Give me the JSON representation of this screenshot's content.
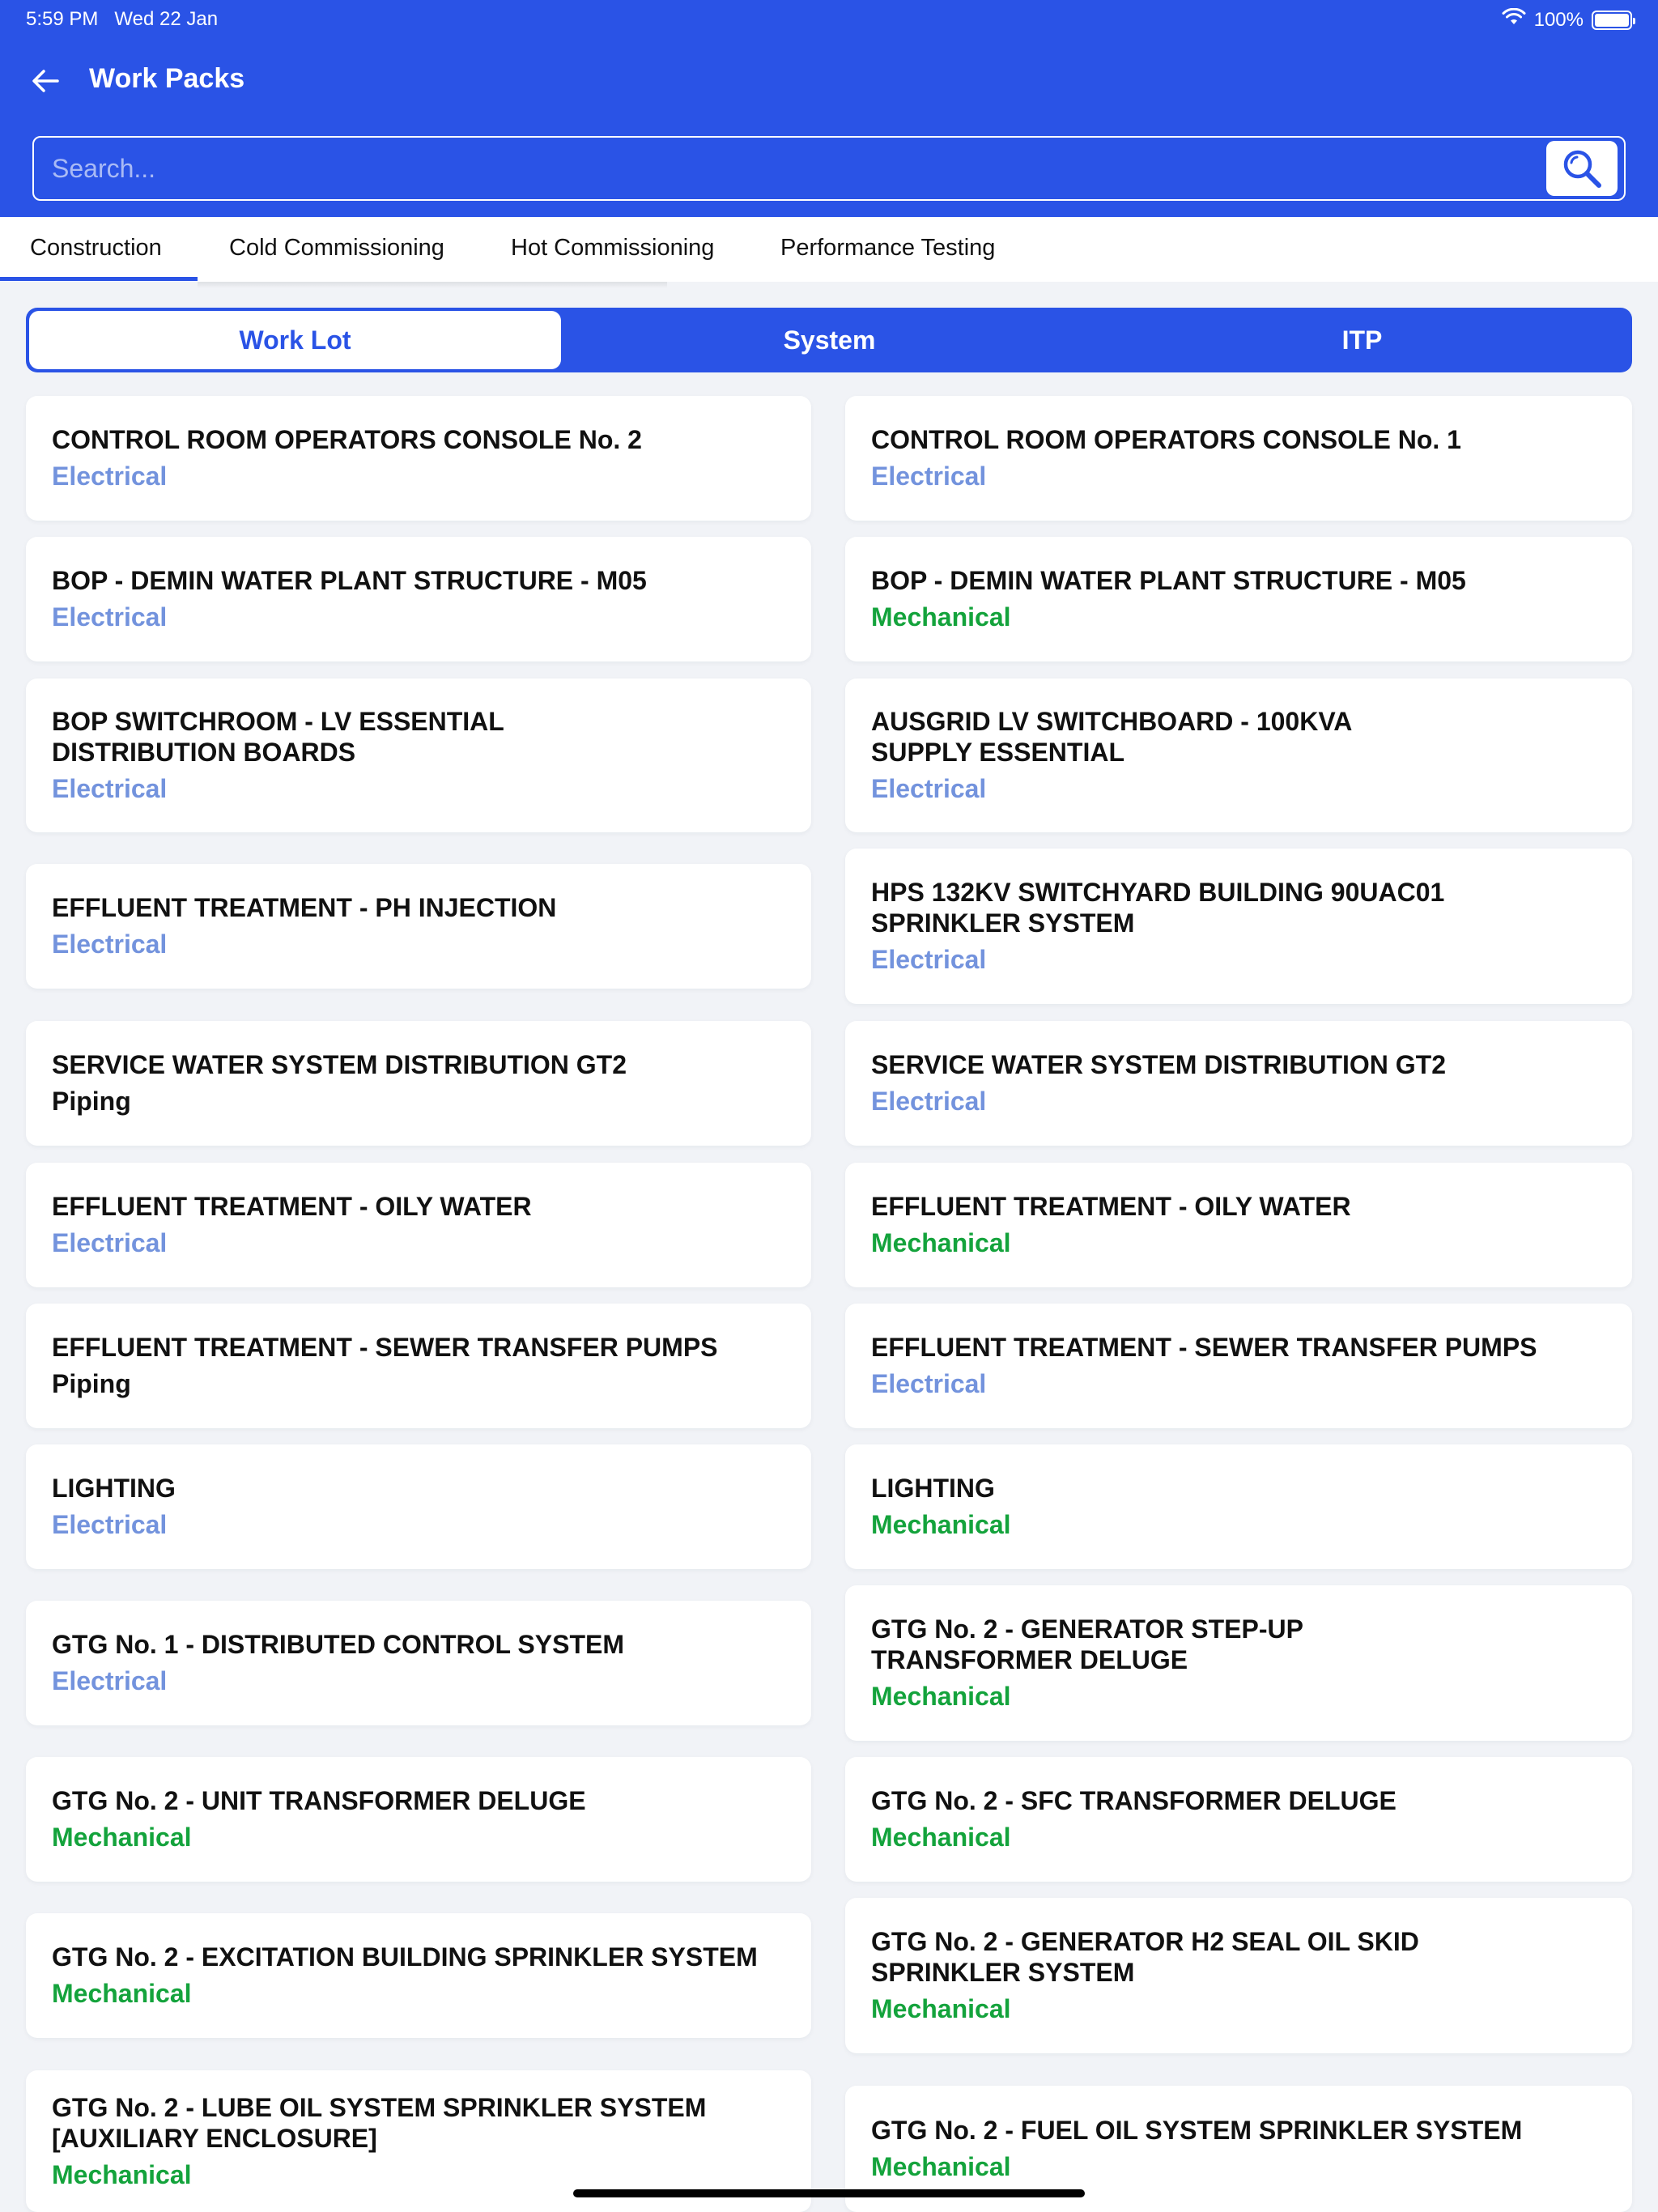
{
  "status": {
    "time": "5:59 PM",
    "date": "Wed 22 Jan",
    "battery": "100%"
  },
  "header": {
    "title": "Work Packs"
  },
  "search": {
    "placeholder": "Search..."
  },
  "tabs": [
    "Construction",
    "Cold Commissioning",
    "Hot Commissioning",
    "Performance Testing"
  ],
  "active_tab": "Construction",
  "segments": [
    "Work Lot",
    "System",
    "ITP"
  ],
  "active_segment": "Work Lot",
  "colors": {
    "accent": "#2a53e6",
    "Electrical": "#7393dd",
    "Mechanical": "#14a33c",
    "Piping": "#111111"
  },
  "cards": {
    "left": [
      {
        "title": "CONTROL ROOM OPERATORS CONSOLE No. 2",
        "discipline": "Electrical"
      },
      {
        "title": "BOP - DEMIN WATER PLANT STRUCTURE - M05",
        "discipline": "Electrical"
      },
      {
        "title": "BOP SWITCHROOM - LV ESSENTIAL\nDISTRIBUTION BOARDS",
        "discipline": "Electrical"
      },
      {
        "title": "EFFLUENT TREATMENT - PH INJECTION",
        "discipline": "Electrical"
      },
      {
        "title": "SERVICE WATER SYSTEM DISTRIBUTION GT2",
        "discipline": "Piping"
      },
      {
        "title": "EFFLUENT TREATMENT - OILY WATER",
        "discipline": "Electrical"
      },
      {
        "title": "EFFLUENT TREATMENT - SEWER TRANSFER PUMPS",
        "discipline": "Piping"
      },
      {
        "title": "LIGHTING",
        "discipline": "Electrical"
      },
      {
        "title": "GTG No. 1 - DISTRIBUTED CONTROL SYSTEM",
        "discipline": "Electrical"
      },
      {
        "title": "GTG No. 2 - UNIT TRANSFORMER DELUGE",
        "discipline": "Mechanical"
      },
      {
        "title": "GTG No. 2 - EXCITATION BUILDING SPRINKLER SYSTEM",
        "discipline": "Mechanical"
      },
      {
        "title": "GTG No. 2 - LUBE OIL SYSTEM SPRINKLER SYSTEM\n[AUXILIARY ENCLOSURE]",
        "discipline": "Mechanical"
      }
    ],
    "right": [
      {
        "title": "CONTROL ROOM OPERATORS CONSOLE No. 1",
        "discipline": "Electrical"
      },
      {
        "title": "BOP - DEMIN WATER PLANT STRUCTURE - M05",
        "discipline": "Mechanical"
      },
      {
        "title": "AUSGRID LV SWITCHBOARD - 100KVA\nSUPPLY ESSENTIAL",
        "discipline": "Electrical"
      },
      {
        "title": "HPS 132KV SWITCHYARD BUILDING 90UAC01\nSPRINKLER SYSTEM",
        "discipline": "Electrical"
      },
      {
        "title": "SERVICE WATER SYSTEM DISTRIBUTION GT2",
        "discipline": "Electrical"
      },
      {
        "title": "EFFLUENT TREATMENT - OILY WATER",
        "discipline": "Mechanical"
      },
      {
        "title": "EFFLUENT TREATMENT - SEWER TRANSFER PUMPS",
        "discipline": "Electrical"
      },
      {
        "title": "LIGHTING",
        "discipline": "Mechanical"
      },
      {
        "title": "GTG No. 2 - GENERATOR STEP-UP\nTRANSFORMER DELUGE",
        "discipline": "Mechanical"
      },
      {
        "title": "GTG No. 2 - SFC TRANSFORMER DELUGE",
        "discipline": "Mechanical"
      },
      {
        "title": "GTG No. 2 - GENERATOR H2 SEAL OIL SKID\nSPRINKLER SYSTEM",
        "discipline": "Mechanical"
      },
      {
        "title": "GTG No. 2 - FUEL OIL SYSTEM SPRINKLER SYSTEM",
        "discipline": "Mechanical"
      }
    ]
  }
}
